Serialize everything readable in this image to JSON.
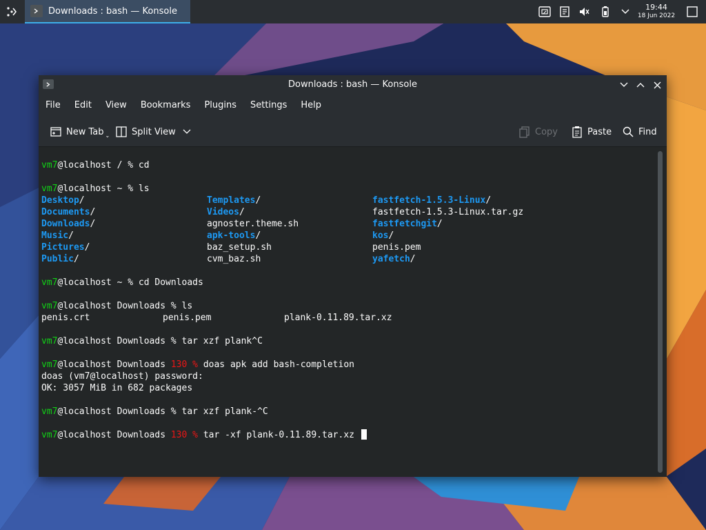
{
  "panel": {
    "task_title": "Downloads : bash — Konsole",
    "clock_time": "19:44",
    "clock_date": "18 Jun 2022",
    "tray_icons": [
      "clipboard-icon",
      "notes-icon",
      "volume-muted-icon",
      "battery-icon",
      "expand-tray-icon",
      "show-desktop-icon"
    ]
  },
  "window": {
    "title": "Downloads : bash — Konsole"
  },
  "menubar": {
    "items": [
      "File",
      "Edit",
      "View",
      "Bookmarks",
      "Plugins",
      "Settings",
      "Help"
    ]
  },
  "toolbar": {
    "new_tab": "New Tab",
    "split_view": "Split View",
    "copy": "Copy",
    "paste": "Paste",
    "find": "Find"
  },
  "terminal": {
    "user": "vm7",
    "ls_home": [
      [
        "Desktop",
        "Templates",
        "fastfetch-1.5.3-Linux"
      ],
      [
        "Documents",
        "Videos",
        "fastfetch-1.5.3-Linux.tar.gz"
      ],
      [
        "Downloads",
        "agnoster.theme.sh",
        "fastfetchgit"
      ],
      [
        "Music",
        "apk-tools",
        "kos"
      ],
      [
        "Pictures",
        "baz_setup.sh",
        "penis.pem"
      ],
      [
        "Public",
        "cvm_baz.sh",
        "yafetch"
      ]
    ],
    "ls_home_slash": [
      [
        "/",
        "/",
        "/"
      ],
      [
        "/",
        "/",
        ""
      ],
      [
        "/",
        "",
        "/"
      ],
      [
        "/",
        "/",
        "/"
      ],
      [
        "/",
        "",
        ""
      ],
      [
        "/",
        "",
        "/"
      ]
    ],
    "l1_host": "@localhost / % ",
    "l1_cmd": "cd",
    "l2_host": "@localhost ~ % ",
    "l2_cmd": "ls",
    "l3_host": "@localhost ~ % ",
    "l3_cmd": "cd Downloads",
    "l4_host": "@localhost Downloads % ",
    "l4_cmd": "ls",
    "ls_dl": [
      "penis.crt",
      "penis.pem",
      "plank-0.11.89.tar.xz"
    ],
    "l5_host": "@localhost Downloads % ",
    "l5_cmd": "tar xzf plank^C",
    "l6_host": "@localhost Downloads ",
    "l6_code": "130 %",
    "l6_cmd": " doas apk add bash-completion",
    "l6_out1": "doas (vm7@localhost) password:",
    "l6_out2": "OK: 3057 MiB in 682 packages",
    "l7_host": "@localhost Downloads % ",
    "l7_cmd": "tar xzf plank-^C",
    "l8_host": "@localhost Downloads ",
    "l8_code": "130 %",
    "l8_cmd": " tar -xf plank-0.11.89.tar.xz "
  },
  "colors": {
    "prompt_user": "#11d116",
    "exit_code": "#ed1515",
    "directory": "#1d99f3",
    "selection_accent": "#3daee9"
  }
}
